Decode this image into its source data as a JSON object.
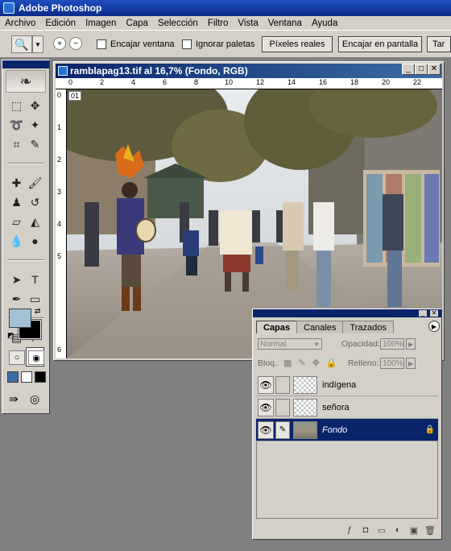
{
  "app": {
    "title": "Adobe Photoshop"
  },
  "menu": [
    "Archivo",
    "Edición",
    "Imagen",
    "Capa",
    "Selección",
    "Filtro",
    "Vista",
    "Ventana",
    "Ayuda"
  ],
  "options": {
    "encajar_ventana": "Encajar ventana",
    "ignorar_paletas": "Ignorar paletas",
    "pixeles_reales": "Píxeles reales",
    "encajar_pantalla": "Encajar en pantalla",
    "tamano_impresion": "Tar"
  },
  "document": {
    "title": "ramblapag13.tif al 16,7% (Fondo, RGB)",
    "ruler_h": [
      "0",
      "2",
      "4",
      "6",
      "8",
      "10",
      "12",
      "14",
      "16",
      "18",
      "20",
      "22"
    ],
    "ruler_v": [
      "0",
      "1",
      "2",
      "3",
      "4",
      "5",
      "6"
    ],
    "slice_label": "01"
  },
  "colors": {
    "foreground": "#a3c1d6",
    "background": "#000000"
  },
  "layers_palette": {
    "tabs": [
      "Capas",
      "Canales",
      "Trazados"
    ],
    "blend_mode": "Normal",
    "opacity_label": "Opacidad:",
    "opacity_value": "100%",
    "lock_label": "Bloq.:",
    "fill_label": "Relleno:",
    "fill_value": "100%",
    "layers": [
      {
        "name": "indígena",
        "selected": false
      },
      {
        "name": "señora",
        "selected": false
      },
      {
        "name": "Fondo",
        "selected": true
      }
    ]
  }
}
